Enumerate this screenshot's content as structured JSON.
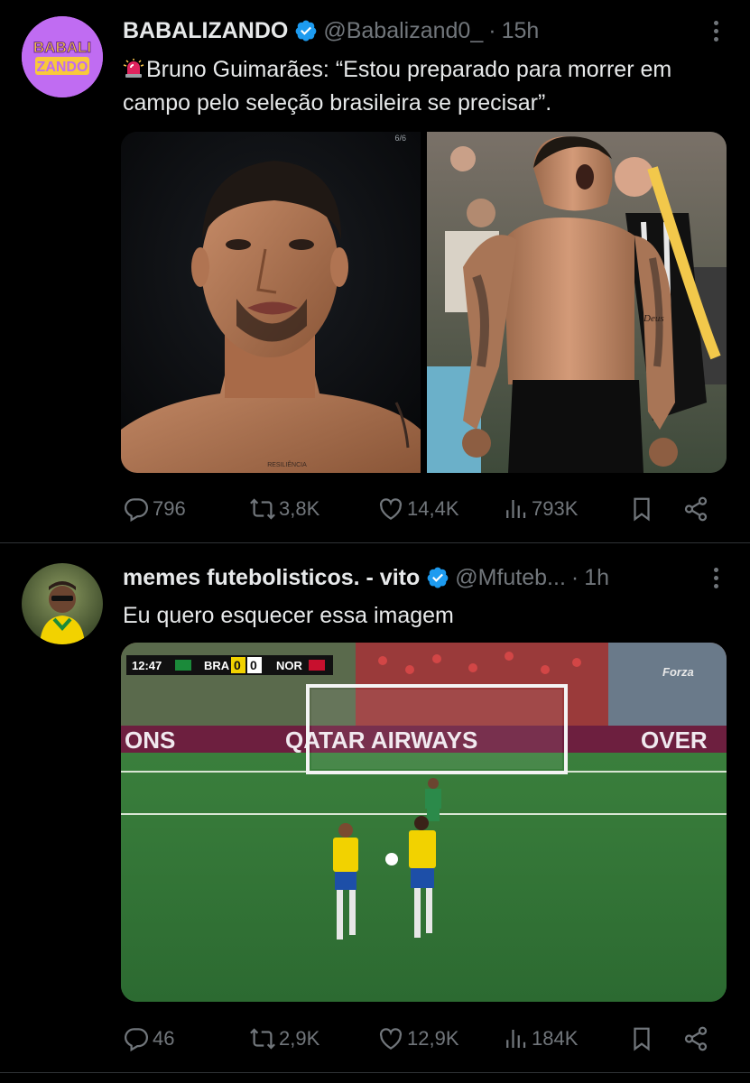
{
  "tweets": [
    {
      "avatar": {
        "line1": "BABALI",
        "line2": "ZANDO"
      },
      "name": "BABALIZANDO",
      "handle": "@Babalizand0_",
      "separator": "·",
      "time": "15h",
      "text_icon": "siren-emoji",
      "text": "Bruno Guimarães: “Estou preparado para morrer em campo pelo seleção brasileira se precisar”.",
      "media": [
        {
          "kind": "photo",
          "counter": "6/6",
          "tattoo": "RESILIÊNCIA",
          "alt_icon": "player-portrait"
        },
        {
          "kind": "photo",
          "arm_text": "Deus",
          "alt_icon": "player-celebration"
        }
      ],
      "actions": {
        "replies": "796",
        "reposts": "3,8K",
        "likes": "14,4K",
        "views": "793K"
      }
    },
    {
      "name": "memes futebolisticos. - vito",
      "handle": "@Mfuteb...",
      "separator": "·",
      "time": "1h",
      "text": "Eu quero esquecer essa imagem",
      "media": [
        {
          "kind": "video-frame",
          "scoreboard": {
            "clock": "12:47",
            "home": "BRA",
            "home_score": "0",
            "away_score": "0",
            "away": "NOR"
          },
          "banner": {
            "left": "ONS",
            "center": "QATAR AIRWAYS",
            "right": "OVER"
          },
          "watermark": "Forza"
        }
      ],
      "actions": {
        "replies": "46",
        "reposts": "2,9K",
        "likes": "12,9K",
        "views": "184K"
      }
    }
  ],
  "colors": {
    "background": "#000000",
    "text": "#e7e9ea",
    "muted": "#71767b",
    "verified": "#1d9bf0",
    "divider": "#2f3336",
    "avatar_purple": "#c06cf2",
    "avatar_yellow": "#f9c93b"
  },
  "icons": [
    "verified-badge-icon",
    "more-icon",
    "reply-icon",
    "repost-icon",
    "like-icon",
    "views-icon",
    "bookmark-icon",
    "share-icon"
  ]
}
